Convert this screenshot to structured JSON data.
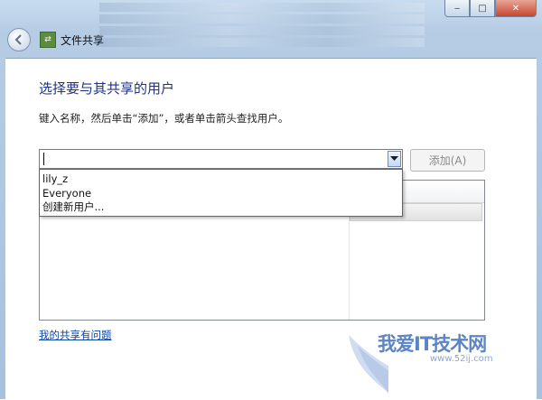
{
  "window": {
    "title": "文件共享",
    "controls": {
      "minimize": "‒",
      "maximize": "□",
      "close": "✕"
    }
  },
  "dialog": {
    "heading": "选择要与其共享的用户",
    "instruction": "键入名称，然后单击“添加”，或者单击箭头查找用户。",
    "name_input": {
      "value": "",
      "placeholder": ""
    },
    "add_button": "添加(A)",
    "dropdown_options": [
      "lily_z",
      "Everyone",
      "创建新用户..."
    ],
    "help_link": "我的共享有问题"
  },
  "watermark": {
    "text": "我爱IT技术网",
    "url": "www.52ij.com"
  },
  "colors": {
    "heading": "#1e3287",
    "link": "#0645ad",
    "frame": "#b6cce4"
  }
}
